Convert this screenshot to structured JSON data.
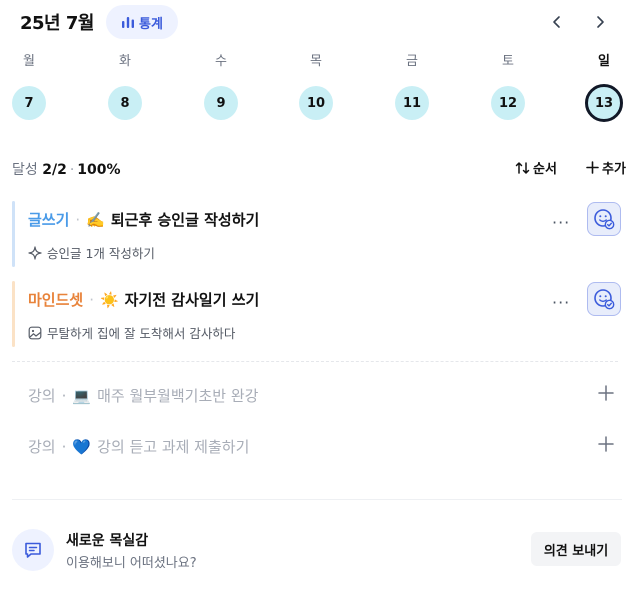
{
  "header": {
    "month_title": "25년 7월",
    "stats_label": "통계"
  },
  "week": {
    "days": [
      {
        "name": "월",
        "date": "7"
      },
      {
        "name": "화",
        "date": "8"
      },
      {
        "name": "수",
        "date": "9"
      },
      {
        "name": "목",
        "date": "10"
      },
      {
        "name": "금",
        "date": "11"
      },
      {
        "name": "토",
        "date": "12"
      },
      {
        "name": "일",
        "date": "13"
      }
    ],
    "today_date": "13"
  },
  "summary": {
    "label": "달성",
    "count": "2/2",
    "separator": "·",
    "percent": "100%",
    "order_label": "순서",
    "add_label": "추가"
  },
  "tasks": [
    {
      "category": "글쓰기",
      "emoji": "✍️",
      "name": "퇴근후 승인글 작성하기",
      "sub": "승인글 1개 작성하기",
      "color": "#4a9be8",
      "bar_color": "#cfe2f8"
    },
    {
      "category": "마인드셋",
      "emoji": "☀️",
      "name": "자기전 감사일기 쓰기",
      "sub": "무탈하게 집에 잘 도착해서 감사하다",
      "color": "#e8833a",
      "bar_color": "#fbe2c6"
    }
  ],
  "pending": [
    {
      "category": "강의",
      "emoji": "💻",
      "name": "매주 월부월백기초반 완강"
    },
    {
      "category": "강의",
      "emoji": "💙",
      "name": "강의 듣고 과제 제출하기"
    }
  ],
  "feedback": {
    "title": "새로운 목실감",
    "subtitle": "이용해보니 어떠셨나요?",
    "button": "의견 보내기"
  },
  "colors": {
    "accent": "#3b5bdb",
    "day_circle": "#c9eff5"
  }
}
